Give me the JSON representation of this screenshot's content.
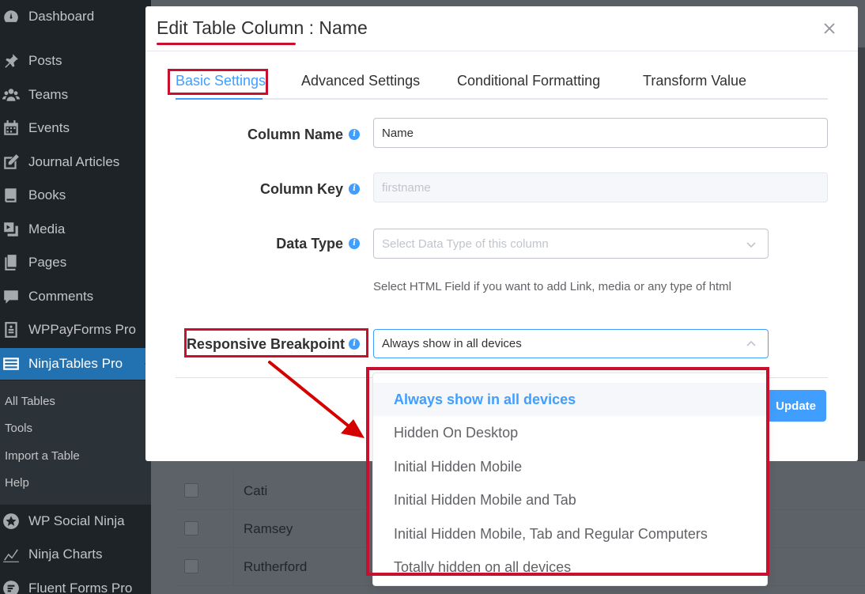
{
  "sidebar": {
    "items": [
      {
        "label": "Dashboard",
        "icon": "dashboard-icon"
      },
      {
        "label": "Posts",
        "icon": "pin-icon"
      },
      {
        "label": "Teams",
        "icon": "group-icon"
      },
      {
        "label": "Events",
        "icon": "calendar-icon"
      },
      {
        "label": "Journal Articles",
        "icon": "edit-icon"
      },
      {
        "label": "Books",
        "icon": "book-icon"
      },
      {
        "label": "Media",
        "icon": "media-icon"
      },
      {
        "label": "Pages",
        "icon": "pages-icon"
      },
      {
        "label": "Comments",
        "icon": "comment-icon"
      },
      {
        "label": "WPPayForms Pro",
        "icon": "form-icon"
      },
      {
        "label": "NinjaTables Pro",
        "icon": "table-icon"
      },
      {
        "label": "WP Social Ninja",
        "icon": "star-icon"
      },
      {
        "label": "Ninja Charts",
        "icon": "chart-icon"
      },
      {
        "label": "Fluent Forms Pro",
        "icon": "forms-icon"
      }
    ],
    "submenu": [
      "All Tables",
      "Tools",
      "Import a Table",
      "Help"
    ]
  },
  "background_table": {
    "rows": [
      "Cati",
      "Ramsey",
      "Rutherford"
    ]
  },
  "modal": {
    "title": "Edit Table Column : Name",
    "tabs": [
      "Basic Settings",
      "Advanced Settings",
      "Conditional Formatting",
      "Transform Value"
    ],
    "fields": {
      "column_name": {
        "label": "Column Name",
        "value": "Name"
      },
      "column_key": {
        "label": "Column Key",
        "value": "firstname"
      },
      "data_type": {
        "label": "Data Type",
        "placeholder": "Select Data Type of this column"
      },
      "hint": "Select HTML Field if you want to add Link, media or any type of html",
      "responsive_breakpoint": {
        "label": "Responsive Breakpoint",
        "value": "Always show in all devices"
      }
    },
    "update_label": "Update"
  },
  "dropdown": {
    "options": [
      "Always show in all devices",
      "Hidden On Desktop",
      "Initial Hidden Mobile",
      "Initial Hidden Mobile and Tab",
      "Initial Hidden Mobile, Tab and Regular Computers",
      "Totally hidden on all devices"
    ],
    "selected_index": 0
  },
  "colors": {
    "accent": "#409eff",
    "annotation": "#c8102e",
    "sidebar_bg": "#1d2327",
    "sidebar_active": "#2271b1"
  }
}
